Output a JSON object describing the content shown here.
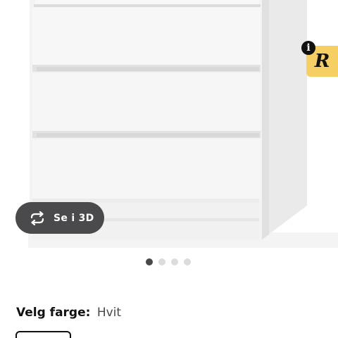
{
  "product": {
    "image_alt": "dresser-product-image"
  },
  "badge": {
    "info_glyph": "i",
    "letter": "R"
  },
  "view_3d": {
    "icon": "rotate-3d-icon",
    "label": "Se i 3D"
  },
  "carousel": {
    "total": 4,
    "active_index": 0
  },
  "color_selector": {
    "label": "Velg farge:",
    "value": "Hvit"
  },
  "colors": {
    "accent_badge": "#f6cf63",
    "button_bg": "#4a4a4c",
    "dot_active": "#484848",
    "dot_inactive": "#dcdcdc"
  }
}
